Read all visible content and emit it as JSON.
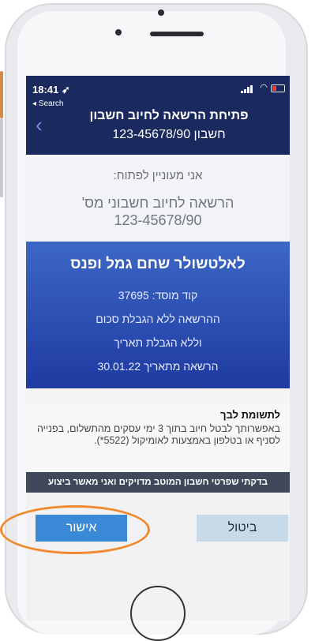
{
  "status_bar": {
    "time": "18:41",
    "location_glyph": "➶",
    "back_app": "◂ Search",
    "wifi_glyph": "◠"
  },
  "nav": {
    "back_glyph": "‹",
    "title": "פתיחת הרשאה לחיוב חשבון",
    "subtitle": "חשבון 123-45678/90"
  },
  "request": {
    "interest_label": "אני מעוניין לפתוח:",
    "mandate_line1": "'הרשאה לחיוב חשבוני מס",
    "mandate_line2": "123-45678/90"
  },
  "fund": {
    "name": "לאלטשולר שחם גמל ופנס",
    "institution_code": "קוד מוסד: 37695",
    "amount_limit": "ההרשאה ללא הגבלת סכום",
    "date_limit": "וללא הגבלת תאריך",
    "start_date": "הרשאה מתאריך 30.01.22"
  },
  "note": {
    "title": "לתשומת לבך",
    "body": "באפשרותך לבטל חיוב בתוך 3 ימי עסקים מהתשלום, בפנייה לסניף או בטלפון באמצעות לאומיקול (5522*)."
  },
  "confirm_text": "בדקתי שפרטי חשבון המוטב מדויקים ואני מאשר ביצוע",
  "buttons": {
    "cancel": "ביטול",
    "approve": "אישור"
  },
  "colors": {
    "nav": "#1b2a5e",
    "card_blue": "#2f52b8",
    "approve": "#3b8ad8",
    "cancel": "#c8d9ea",
    "highlight": "#f08a2c"
  }
}
